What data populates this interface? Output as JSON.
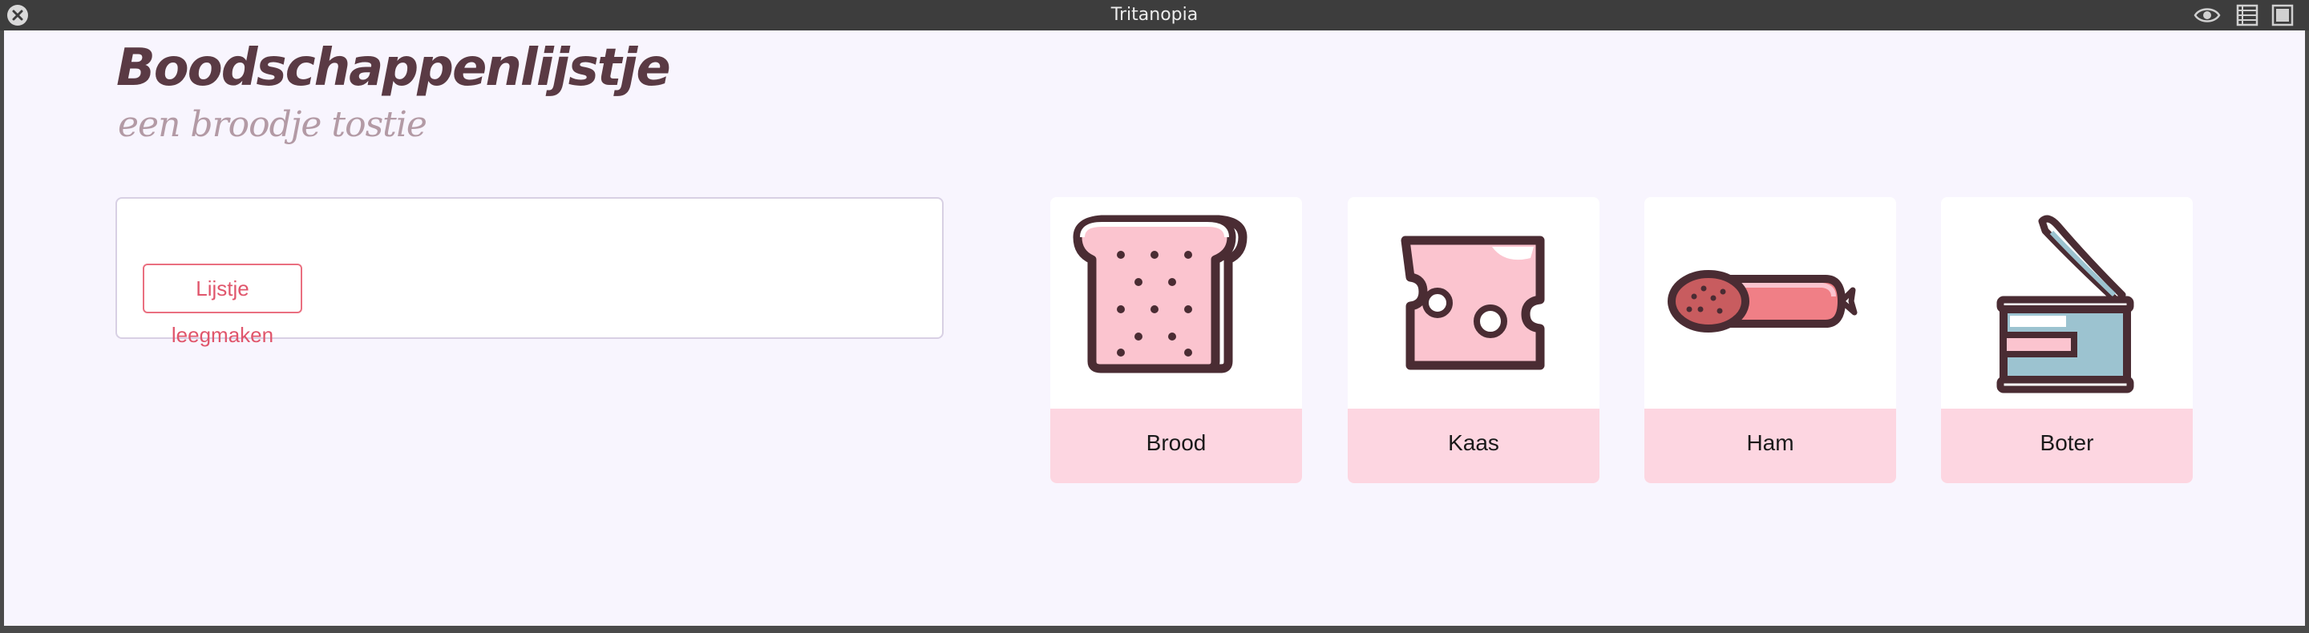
{
  "window": {
    "title": "Tritanopia",
    "icons": [
      "close-icon",
      "eye-icon",
      "list-view-icon",
      "window-icon"
    ]
  },
  "app": {
    "title": "Boodschappenlijstje",
    "subtitle": "een broodje tostie",
    "clear_button_label": "Lijstje leegmaken",
    "products": [
      {
        "name": "Brood",
        "icon": "bread-icon"
      },
      {
        "name": "Kaas",
        "icon": "cheese-icon"
      },
      {
        "name": "Ham",
        "icon": "ham-icon"
      },
      {
        "name": "Boter",
        "icon": "butter-tin-icon"
      }
    ]
  },
  "colors": {
    "accent": "#e0566c",
    "label_background": "#fdd6e1",
    "page_background": "#f8f5fe",
    "heading": "#5a3a44",
    "icon_outline": "#4a2c33",
    "icon_fill_pink": "#fbc4cf",
    "icon_fill_red": "#f07f86",
    "icon_fill_blue": "#9cc3d0"
  }
}
